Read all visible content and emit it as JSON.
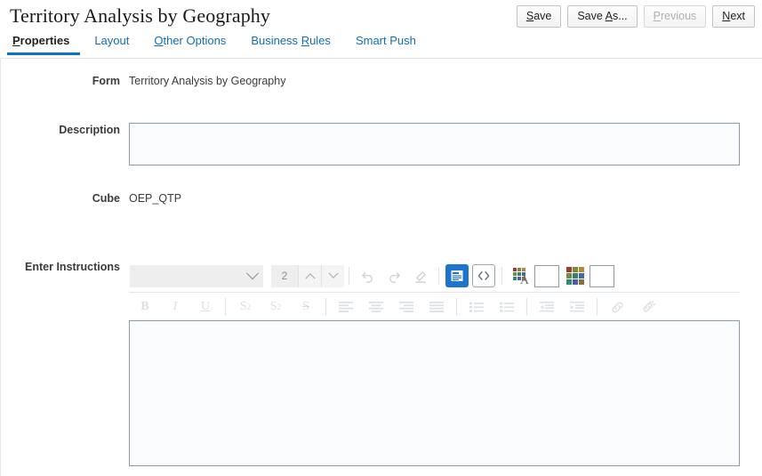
{
  "header": {
    "title": "Territory Analysis by Geography",
    "buttons": [
      {
        "name": "save-button",
        "label_pre": "",
        "label_accel": "S",
        "label_post": "ave",
        "disabled": false
      },
      {
        "name": "save-as-button",
        "label_pre": "Save ",
        "label_accel": "A",
        "label_post": "s...",
        "disabled": false
      },
      {
        "name": "previous-button",
        "label_pre": "",
        "label_accel": "P",
        "label_post": "revious",
        "disabled": true
      },
      {
        "name": "next-button",
        "label_pre": "",
        "label_accel": "N",
        "label_post": "ext",
        "disabled": false
      }
    ]
  },
  "tabs": [
    {
      "name": "tab-properties",
      "pre": "",
      "accel": "P",
      "post": "roperties",
      "active": true
    },
    {
      "name": "tab-layout",
      "pre": "Layout",
      "accel": "",
      "post": "",
      "active": false
    },
    {
      "name": "tab-other-options",
      "pre": "",
      "accel": "O",
      "post": "ther Options",
      "active": false
    },
    {
      "name": "tab-business-rules",
      "pre": "Business ",
      "accel": "R",
      "post": "ules",
      "active": false
    },
    {
      "name": "tab-smart-push",
      "pre": "Smart Push",
      "accel": "",
      "post": "",
      "active": false
    }
  ],
  "fields": {
    "form": {
      "label": "Form",
      "value": "Territory Analysis by Geography"
    },
    "description": {
      "label": "Description",
      "value": "",
      "placeholder": ""
    },
    "cube": {
      "label": "Cube",
      "value": "OEP_QTP"
    },
    "instructions": {
      "label": "Enter Instructions",
      "value": "",
      "placeholder": ""
    }
  },
  "editor": {
    "font_family_value": "",
    "font_size_value": "2",
    "tools_row1": [
      {
        "name": "undo-icon",
        "title": "Undo",
        "disabled": true
      },
      {
        "name": "redo-icon",
        "title": "Redo",
        "disabled": true
      },
      {
        "name": "format-painter-icon",
        "title": "Format Painter",
        "disabled": true
      },
      {
        "name": "rich-text-view-icon",
        "title": "Rich Text",
        "active": true
      },
      {
        "name": "source-code-icon",
        "title": "Source Code",
        "disabled": false
      },
      {
        "name": "font-color-icon",
        "title": "Font Color",
        "disabled": false
      },
      {
        "name": "font-color-swatch",
        "title": "Font Color Swatch",
        "disabled": false
      },
      {
        "name": "background-color-icon",
        "title": "Background Color",
        "disabled": false
      },
      {
        "name": "background-color-swatch",
        "title": "Background Color Swatch",
        "disabled": false
      }
    ],
    "tools_row2": [
      {
        "name": "bold-icon",
        "title": "Bold",
        "disabled": true
      },
      {
        "name": "italic-icon",
        "title": "Italic",
        "disabled": true
      },
      {
        "name": "underline-icon",
        "title": "Underline",
        "disabled": true
      },
      {
        "name": "subscript-icon",
        "title": "Subscript",
        "disabled": true
      },
      {
        "name": "superscript-icon",
        "title": "Superscript",
        "disabled": true
      },
      {
        "name": "strikethrough-icon",
        "title": "Strikethrough",
        "disabled": true
      },
      {
        "name": "align-left-icon",
        "title": "Align Left",
        "disabled": true
      },
      {
        "name": "align-center-icon",
        "title": "Align Center",
        "disabled": true
      },
      {
        "name": "align-right-icon",
        "title": "Align Right",
        "disabled": true
      },
      {
        "name": "align-justify-icon",
        "title": "Justify",
        "disabled": true
      },
      {
        "name": "bulleted-list-icon",
        "title": "Bulleted List",
        "disabled": true
      },
      {
        "name": "numbered-list-icon",
        "title": "Numbered List",
        "disabled": true
      },
      {
        "name": "outdent-icon",
        "title": "Outdent",
        "disabled": true
      },
      {
        "name": "indent-icon",
        "title": "Indent",
        "disabled": true
      },
      {
        "name": "link-icon",
        "title": "Insert Link",
        "disabled": true
      },
      {
        "name": "unlink-icon",
        "title": "Remove Link",
        "disabled": true
      }
    ],
    "swatch_color": "#ffffff",
    "palette_colors": [
      "#9c3a33",
      "#7d8a3a",
      "#b08a2e",
      "#6f8f3f",
      "#3f7d6f",
      "#3a6f9c",
      "#2f8a7a",
      "#4a5fa8",
      "#8a6f3a"
    ]
  },
  "colors": {
    "accent_blue": "#0a72c4",
    "active_tool_blue": "#1c74cd",
    "link_blue": "#0f6fb4",
    "field_border": "#8d9ba6",
    "field_fill": "#fafcfd"
  }
}
